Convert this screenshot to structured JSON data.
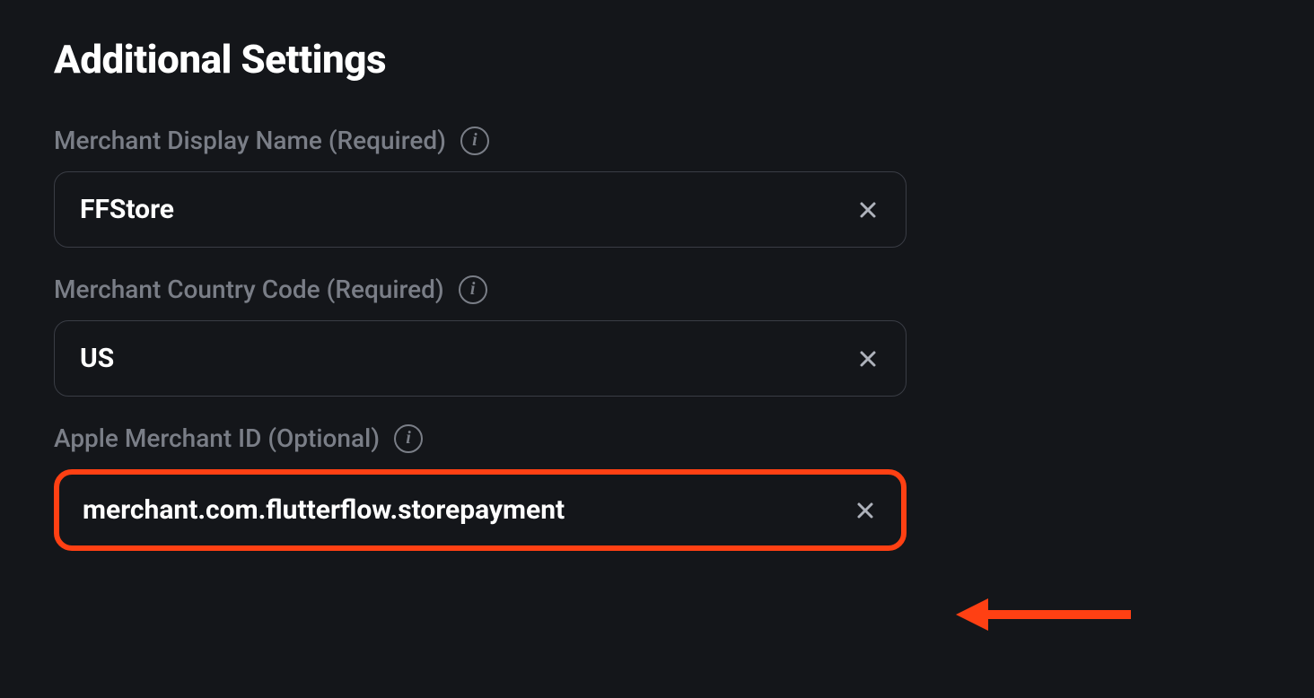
{
  "page": {
    "title": "Additional Settings"
  },
  "fields": {
    "merchantDisplayName": {
      "label": "Merchant Display Name (Required)",
      "value": "FFStore"
    },
    "merchantCountryCode": {
      "label": "Merchant Country Code (Required)",
      "value": "US"
    },
    "appleMerchantId": {
      "label": "Apple Merchant ID (Optional)",
      "value": "merchant.com.flutterflow.storepayment"
    }
  },
  "colors": {
    "highlight": "#ff4013",
    "background": "#14161a",
    "border": "#3a3d45",
    "labelText": "#7a7e87",
    "valueText": "#ffffff"
  }
}
